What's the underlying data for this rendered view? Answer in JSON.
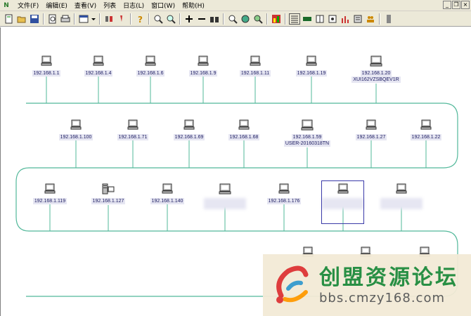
{
  "menubar": {
    "items": [
      "文件(F)",
      "编辑(E)",
      "查看(V)",
      "列表",
      "日志(L)",
      "窗口(W)",
      "帮助(H)"
    ]
  },
  "toolbar": {
    "icons": [
      "new-icon",
      "open-icon",
      "save-icon",
      "preview-icon",
      "print-icon",
      "layout-icon",
      "dropdown-icon",
      "tool-icon",
      "pen-icon",
      "help-icon",
      "zoom-in-icon",
      "zoom-out-icon",
      "add-icon",
      "remove-icon",
      "binoculars-icon",
      "find-icon",
      "globe-icon",
      "search-refresh-icon",
      "chart-icon",
      "list-icon",
      "view1-icon",
      "view2-icon",
      "view3-icon",
      "bar-chart-icon",
      "printer2-icon",
      "users-icon",
      "stop-icon"
    ]
  },
  "nodes_row1": [
    {
      "ip": "192.168.1.1"
    },
    {
      "ip": "192.168.1.4"
    },
    {
      "ip": "192.168.1.6"
    },
    {
      "ip": "192.168.1.9"
    },
    {
      "ip": "192.168.1.11"
    },
    {
      "ip": "192.168.1.19"
    },
    {
      "ip": "192.168.1.20",
      "host": "XUI162VZSBQEV1R"
    }
  ],
  "nodes_row2": [
    {
      "ip": "192.168.1.100"
    },
    {
      "ip": "192.168.1.71"
    },
    {
      "ip": "192.168.1.69"
    },
    {
      "ip": "192.168.1.68"
    },
    {
      "ip": "192.168.1.59",
      "host": "USER-20160318TN"
    },
    {
      "ip": "192.168.1.27"
    },
    {
      "ip": "192.168.1.22"
    }
  ],
  "nodes_row3": [
    {
      "ip": "192.168.1.119"
    },
    {
      "ip": "192.168.1.127"
    },
    {
      "ip": "192.168.1.140"
    },
    {
      "ip": ""
    },
    {
      "ip": "192.168.1.176"
    },
    {
      "ip": ""
    },
    {
      "ip": ""
    }
  ],
  "watermark": {
    "title": "创盟资源论坛",
    "url": "bbs.cmzy168.com"
  },
  "colors": {
    "bus_line": "#52b89a",
    "label_bg": "#e6e6f2",
    "label_text": "#1a1a60",
    "selection": "#3a3aa8"
  }
}
